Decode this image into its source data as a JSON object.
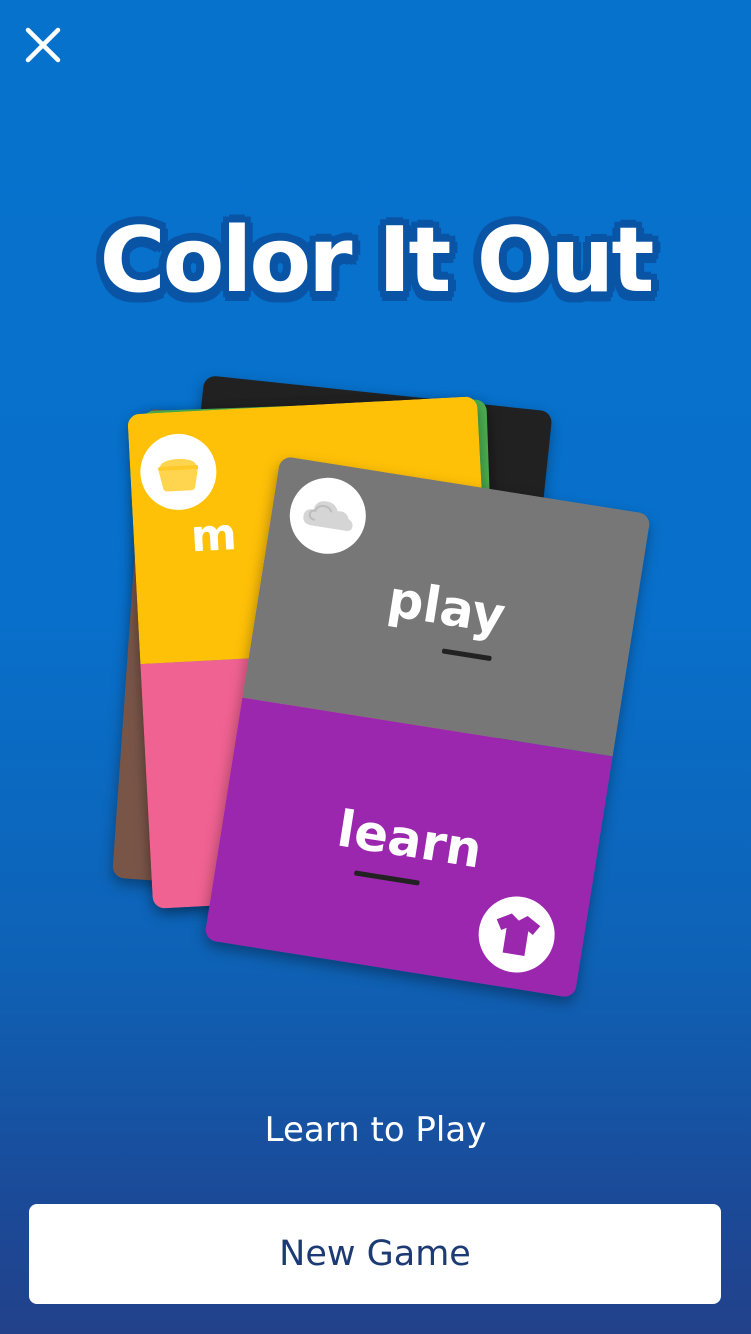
{
  "header": {
    "close_icon": "close-icon",
    "title": "Color It Out"
  },
  "cards": {
    "front": {
      "top_color": "#777777",
      "bottom_color": "#9B27AF",
      "top_word": "play",
      "bottom_word": "learn",
      "top_icon": "cloud-icon",
      "bottom_icon": "shirt-icon"
    },
    "yellow": {
      "top_color": "#FFC107",
      "bottom_color": "#F06292",
      "visible_word": "m",
      "icon": "basket-icon"
    },
    "green": {
      "color": "#4CAF50"
    },
    "black": {
      "color": "#212121"
    },
    "brown": {
      "color": "#795548"
    }
  },
  "actions": {
    "learn_to_play": "Learn to Play",
    "new_game": "New Game"
  },
  "colors": {
    "background_top": "#0672CC",
    "background_bottom": "#22418A",
    "title_outline": "#0A54A6",
    "button_text": "#1C3A73"
  }
}
